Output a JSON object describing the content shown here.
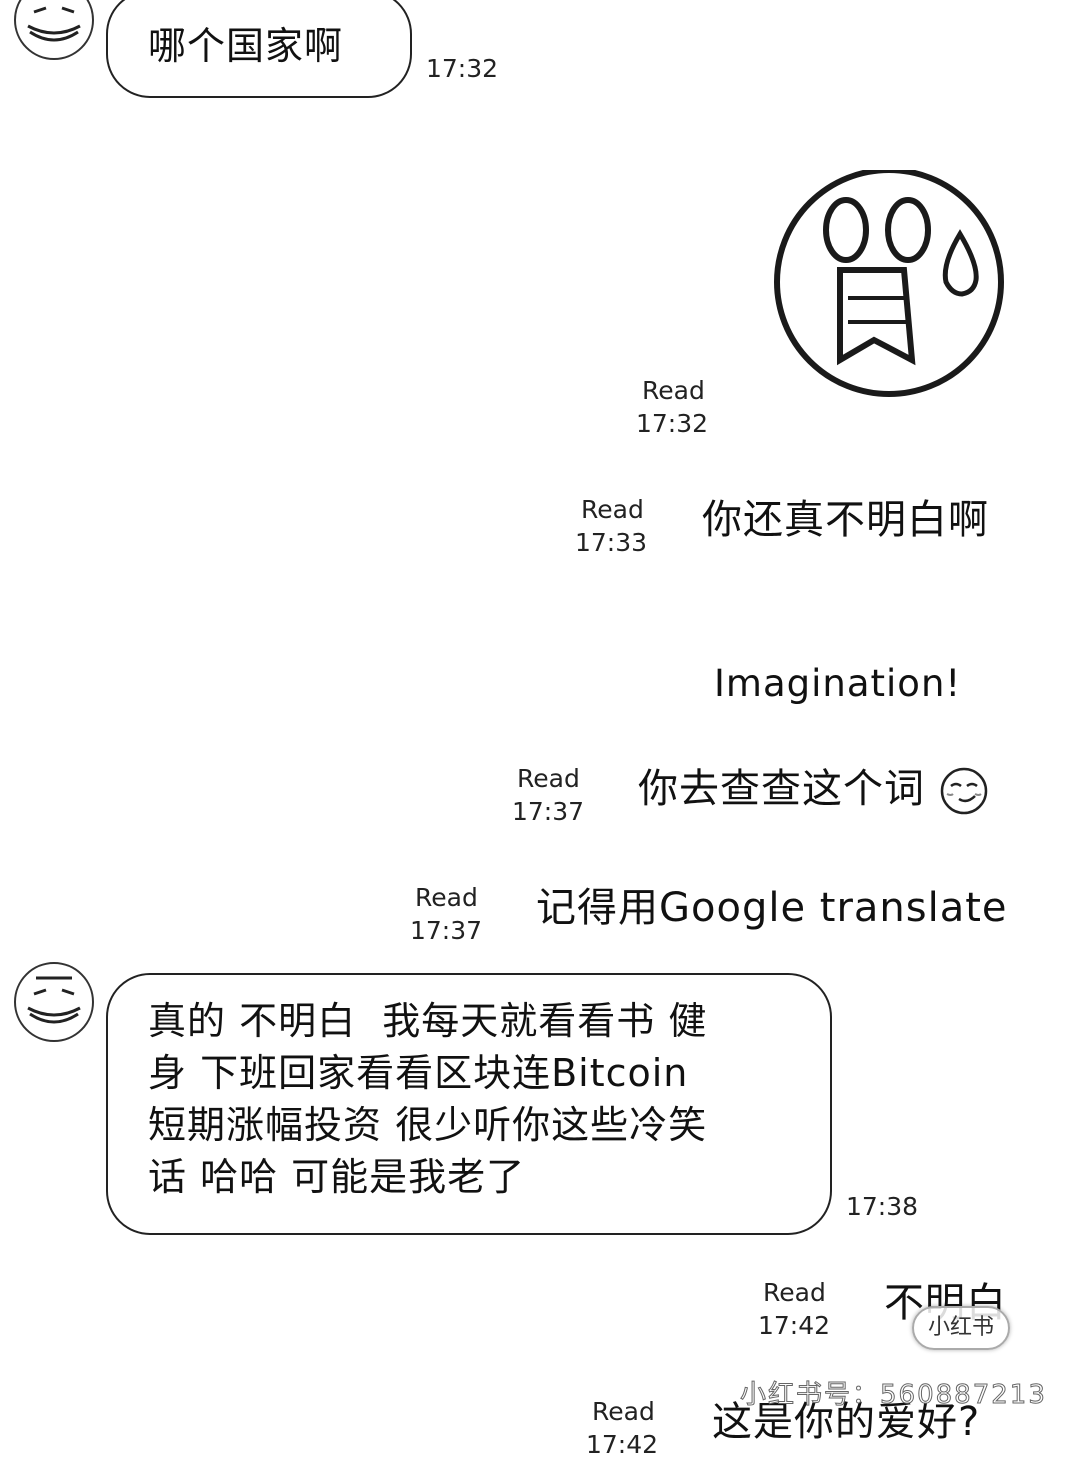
{
  "messages": {
    "m1": {
      "text": "哪个国家啊",
      "time": "17:32"
    },
    "m2": {
      "read": "Read",
      "time": "17:32",
      "sticker": "shocked-face-sticker"
    },
    "m3": {
      "text": "你还真不明白啊",
      "read": "Read",
      "time": "17:33"
    },
    "m4": {
      "text": "Imagination!"
    },
    "m5": {
      "text": "你去查查这个词",
      "read": "Read",
      "time": "17:37",
      "emoji": "smirk-emoji"
    },
    "m6": {
      "text": "记得用Google translate",
      "read": "Read",
      "time": "17:37"
    },
    "m7": {
      "lines": [
        "真的 不明白  我每天就看看书 健",
        "身 下班回家看看区块连Bitcoin",
        "短期涨幅投资 很少听你这些冷笑",
        "话 哈哈 可能是我老了"
      ],
      "time": "17:38"
    },
    "m8": {
      "text": "不明白",
      "read": "Read",
      "time": "17:42"
    },
    "m9": {
      "text": "这是你的爱好?",
      "read": "Read",
      "time": "17:42"
    }
  },
  "watermark": {
    "badge": "小红书",
    "id": "小红书号：560887213"
  },
  "colors": {
    "background": "#ffffff",
    "bubble_border": "#222222",
    "text": "#111111"
  }
}
